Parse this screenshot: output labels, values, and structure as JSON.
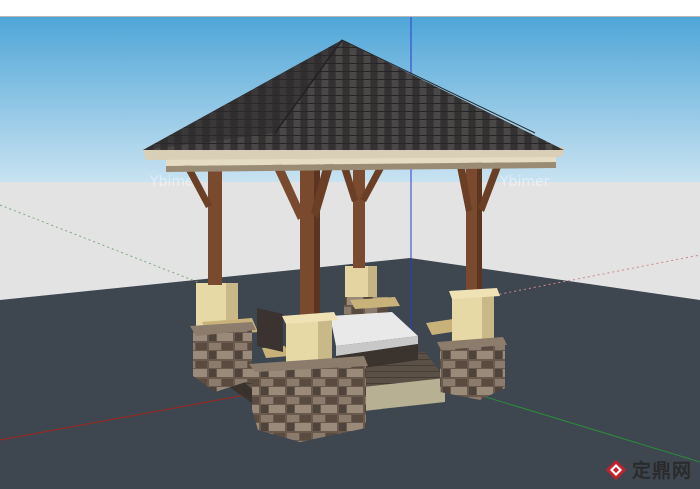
{
  "colors": {
    "sky_top": "#4fa6d8",
    "sky_bottom": "#c9e3f1",
    "horizon_band": "#e3e3e3",
    "ground": "#3e4650",
    "roof": "#3a3838",
    "timber": "#7a4a2e",
    "render_wall": "#e7d9a6",
    "stone": "#6e5e52",
    "deck": "#5c5146",
    "axis_blue": "#2a3fc4",
    "axis_red": "#a1271c",
    "axis_green": "#2a8c3a"
  },
  "watermark": {
    "left_text": "Ybimer",
    "right_text": "Ybimer"
  },
  "brand": {
    "logo_icon": "diamond-logo-icon",
    "name": "定鼎网"
  }
}
